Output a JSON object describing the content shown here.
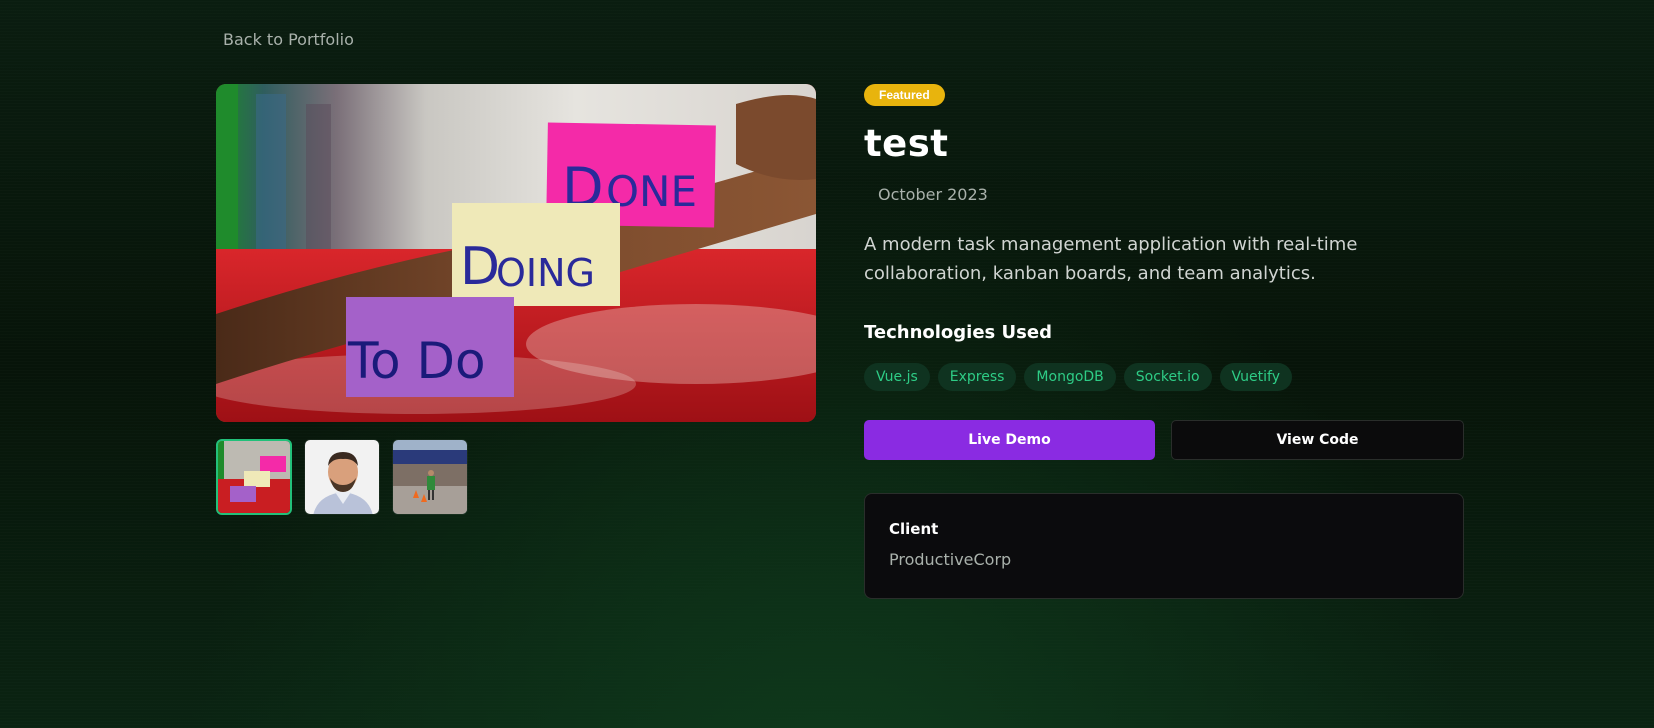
{
  "nav": {
    "back_label": "Back to Portfolio"
  },
  "project": {
    "badge": "Featured",
    "title": "test",
    "date": "October 2023",
    "description": "A modern task management application with real-time collaboration, kanban boards, and team analytics.",
    "tech_heading": "Technologies Used",
    "technologies": [
      "Vue.js",
      "Express",
      "MongoDB",
      "Socket.io",
      "Vuetify"
    ],
    "live_demo_label": "Live Demo",
    "view_code_label": "View Code",
    "client_label": "Client",
    "client_value": "ProductiveCorp"
  },
  "gallery": {
    "main_image": "sticky-notes-todo-doing-done-photo",
    "main_notes": [
      "Done",
      "Doing",
      "To Do"
    ],
    "thumbnails": [
      {
        "name": "sticky-notes-thumbnail",
        "active": true
      },
      {
        "name": "portrait-man-thumbnail",
        "active": false
      },
      {
        "name": "runner-race-thumbnail",
        "active": false
      }
    ]
  },
  "colors": {
    "badge": "#e8b40d",
    "tag_text": "#2ecc86",
    "tag_bg": "#0f3320",
    "live_demo": "#8a2be2",
    "active_thumb_border": "#22c07a"
  }
}
